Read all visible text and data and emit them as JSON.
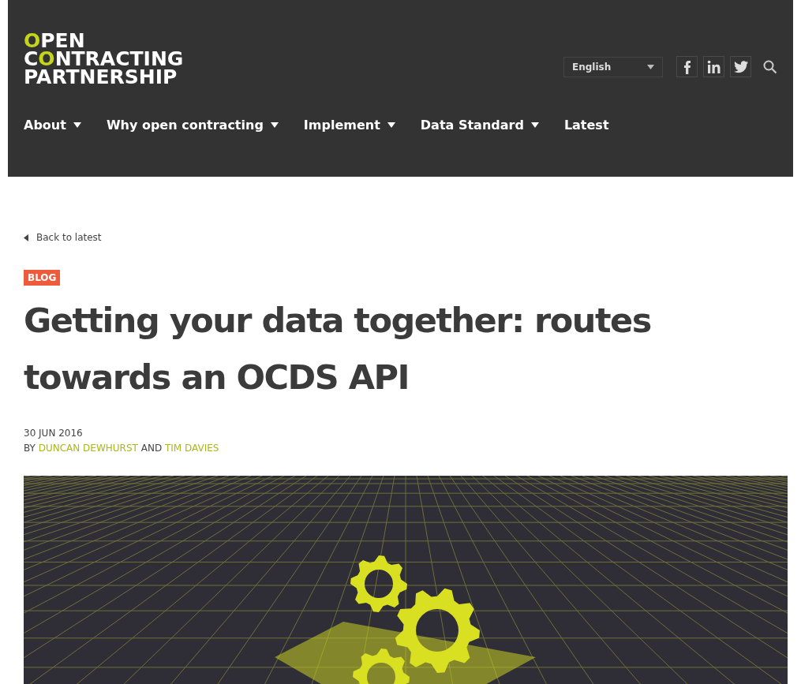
{
  "logo": {
    "lines": [
      {
        "parts": [
          {
            "text": "O",
            "accent": true
          },
          {
            "text": "PEN",
            "accent": false
          }
        ]
      },
      {
        "parts": [
          {
            "text": "C",
            "accent": false
          },
          {
            "text": "O",
            "accent": true
          },
          {
            "text": "NTRACTING",
            "accent": false
          }
        ]
      },
      {
        "parts": [
          {
            "text": "PARTNERSHIP",
            "accent": false
          }
        ]
      }
    ]
  },
  "language": {
    "value": "English"
  },
  "social": [
    {
      "kind": "facebook"
    },
    {
      "kind": "linkedin"
    },
    {
      "kind": "twitter"
    }
  ],
  "nav": [
    {
      "label": "About",
      "has_menu": true
    },
    {
      "label": "Why open contracting",
      "has_menu": true
    },
    {
      "label": "Implement",
      "has_menu": true
    },
    {
      "label": "Data Standard",
      "has_menu": true
    },
    {
      "label": "Latest",
      "has_menu": false
    }
  ],
  "back_link": "Back to latest",
  "category": "BLOG",
  "title": "Getting your data together: routes towards an OCDS API",
  "date": "30 JUN 2016",
  "byline": {
    "prefix": "BY",
    "authors": [
      "DUNCAN DEWHURST",
      "TIM DAVIES"
    ],
    "joiner": "AND"
  }
}
